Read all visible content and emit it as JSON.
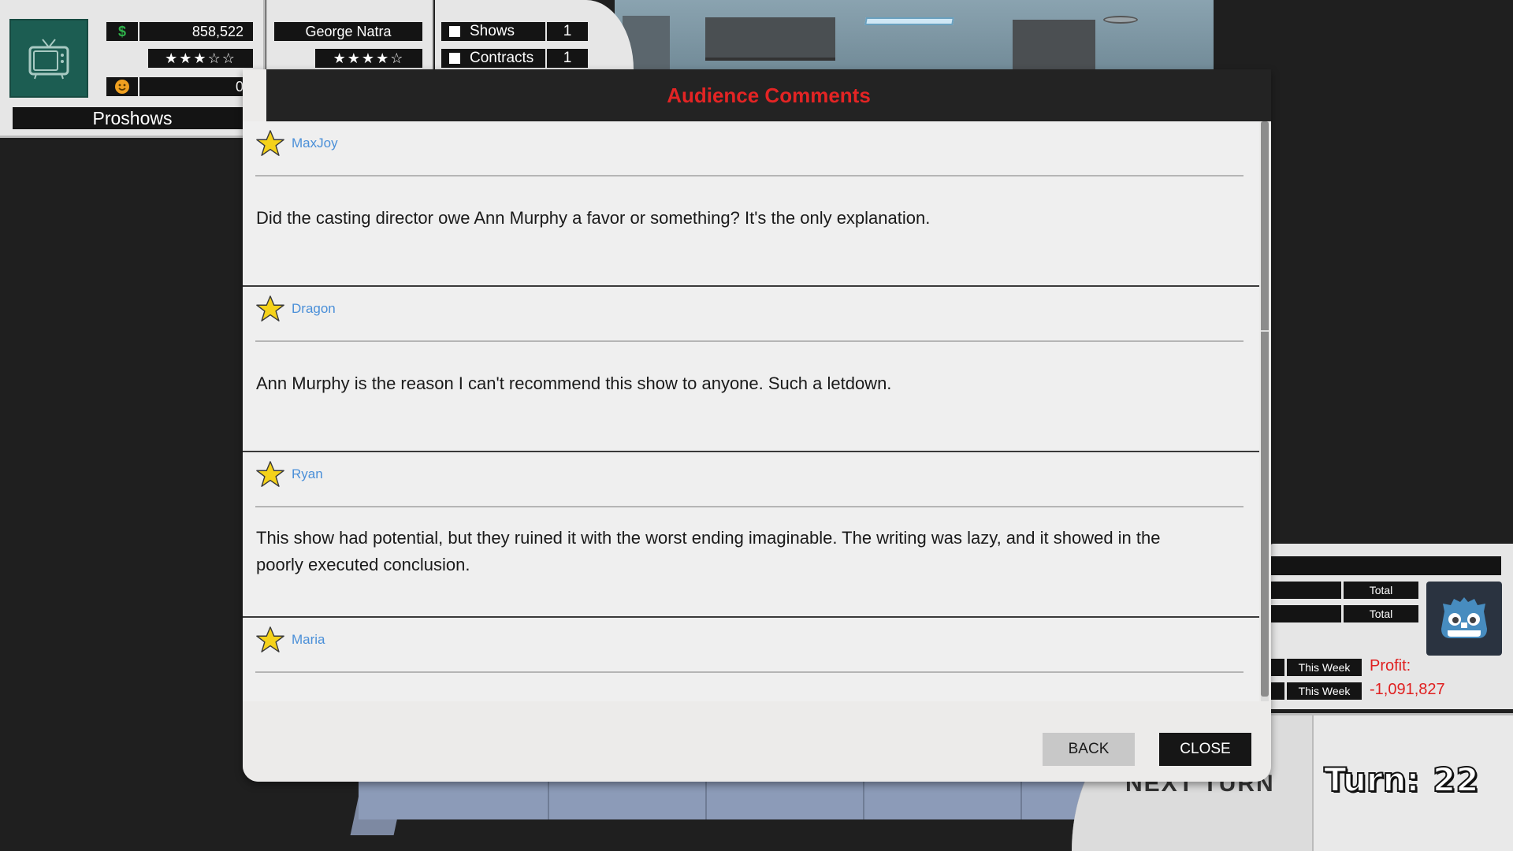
{
  "studio": {
    "money_icon": "$",
    "money": "858,522",
    "rating_stars": "★★★☆☆",
    "fans": "0",
    "name": "Proshows",
    "logo_icon": "tv-icon",
    "fans_icon": "smiley-icon"
  },
  "producer": {
    "name": "George Natra",
    "rating_stars": "★★★★☆"
  },
  "counts": {
    "shows_label": "Shows",
    "shows_value": "1",
    "contracts_label": "Contracts",
    "contracts_value": "1"
  },
  "modal": {
    "title": "Audience Comments",
    "comments": [
      {
        "user": "MaxJoy",
        "text": "Did the casting director owe Ann Murphy a favor or something? It's the only explanation."
      },
      {
        "user": "Dragon",
        "text": "Ann Murphy is the reason I can't recommend this show to anyone. Such a letdown."
      },
      {
        "user": "Ryan",
        "text": "This show had potential, but they ruined it with the worst ending imaginable. The writing was lazy, and it showed in the poorly executed conclusion."
      },
      {
        "user": "Maria",
        "text": ""
      }
    ],
    "back_label": "BACK",
    "close_label": "CLOSE"
  },
  "right_panel": {
    "total_label_1": "Total",
    "total_label_2": "Total",
    "this_week_label_1": "This Week",
    "this_week_label_2": "This Week",
    "profit_label": "Profit:",
    "profit_value": "-1,091,827",
    "avatar_icon": "godot-robot-icon"
  },
  "turn": {
    "next_turn_label": "NEXT TURN",
    "turn_label": "Turn:",
    "turn_value": "22"
  },
  "colors": {
    "accent_red": "#e32424",
    "username_blue": "#4a8fd8",
    "money_green": "#2fb24a",
    "star_yellow": "#f5d21a"
  }
}
